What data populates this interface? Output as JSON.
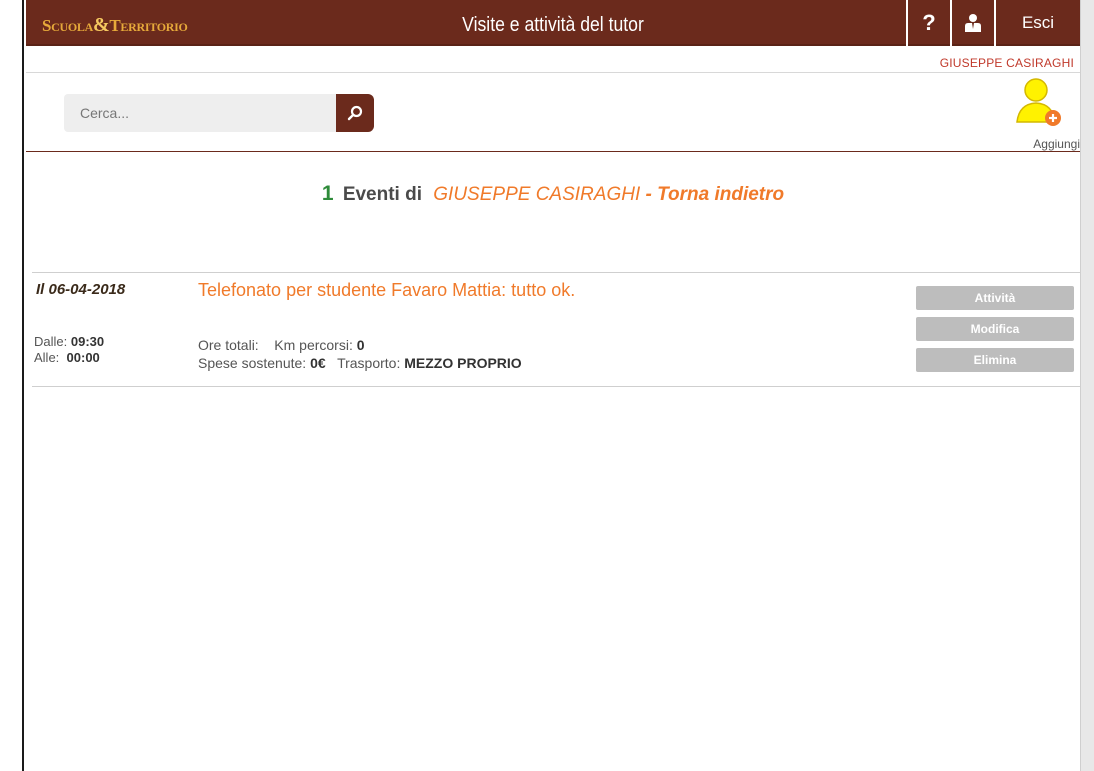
{
  "header": {
    "logo": {
      "part1": "Scuola",
      "amp": "&",
      "part2": "Territorio"
    },
    "title": "Visite e attività del tutor",
    "help_label": "?",
    "exit_label": "Esci",
    "color": "#6b2a1c"
  },
  "user": {
    "name": "GIUSEPPE CASIRAGHI"
  },
  "search": {
    "placeholder": "Cerca..."
  },
  "add": {
    "label": "Aggiungi"
  },
  "heading": {
    "count": "1",
    "label": "Eventi di",
    "who": "GIUSEPPE CASIRAGHI",
    "back": "- Torna indietro"
  },
  "events": [
    {
      "date": "Il 06-04-2018",
      "description": "Telefonato per studente Favaro Mattia: tutto ok.",
      "from_label": "Dalle:",
      "from": "09:30",
      "to_label": "Alle:",
      "to": "00:00",
      "hours_label": "Ore totali:",
      "hours": "",
      "km_label": "Km percorsi:",
      "km": "0",
      "expenses_label": "Spese sostenute:",
      "expenses": "0€",
      "transport_label": "Trasporto:",
      "transport": "MEZZO PROPRIO",
      "actions": [
        "Attività",
        "Modifica",
        "Elimina"
      ]
    }
  ],
  "icons": {
    "search": "search-icon",
    "help": "help-icon",
    "user": "user-icon",
    "add_user": "add-user-icon"
  }
}
